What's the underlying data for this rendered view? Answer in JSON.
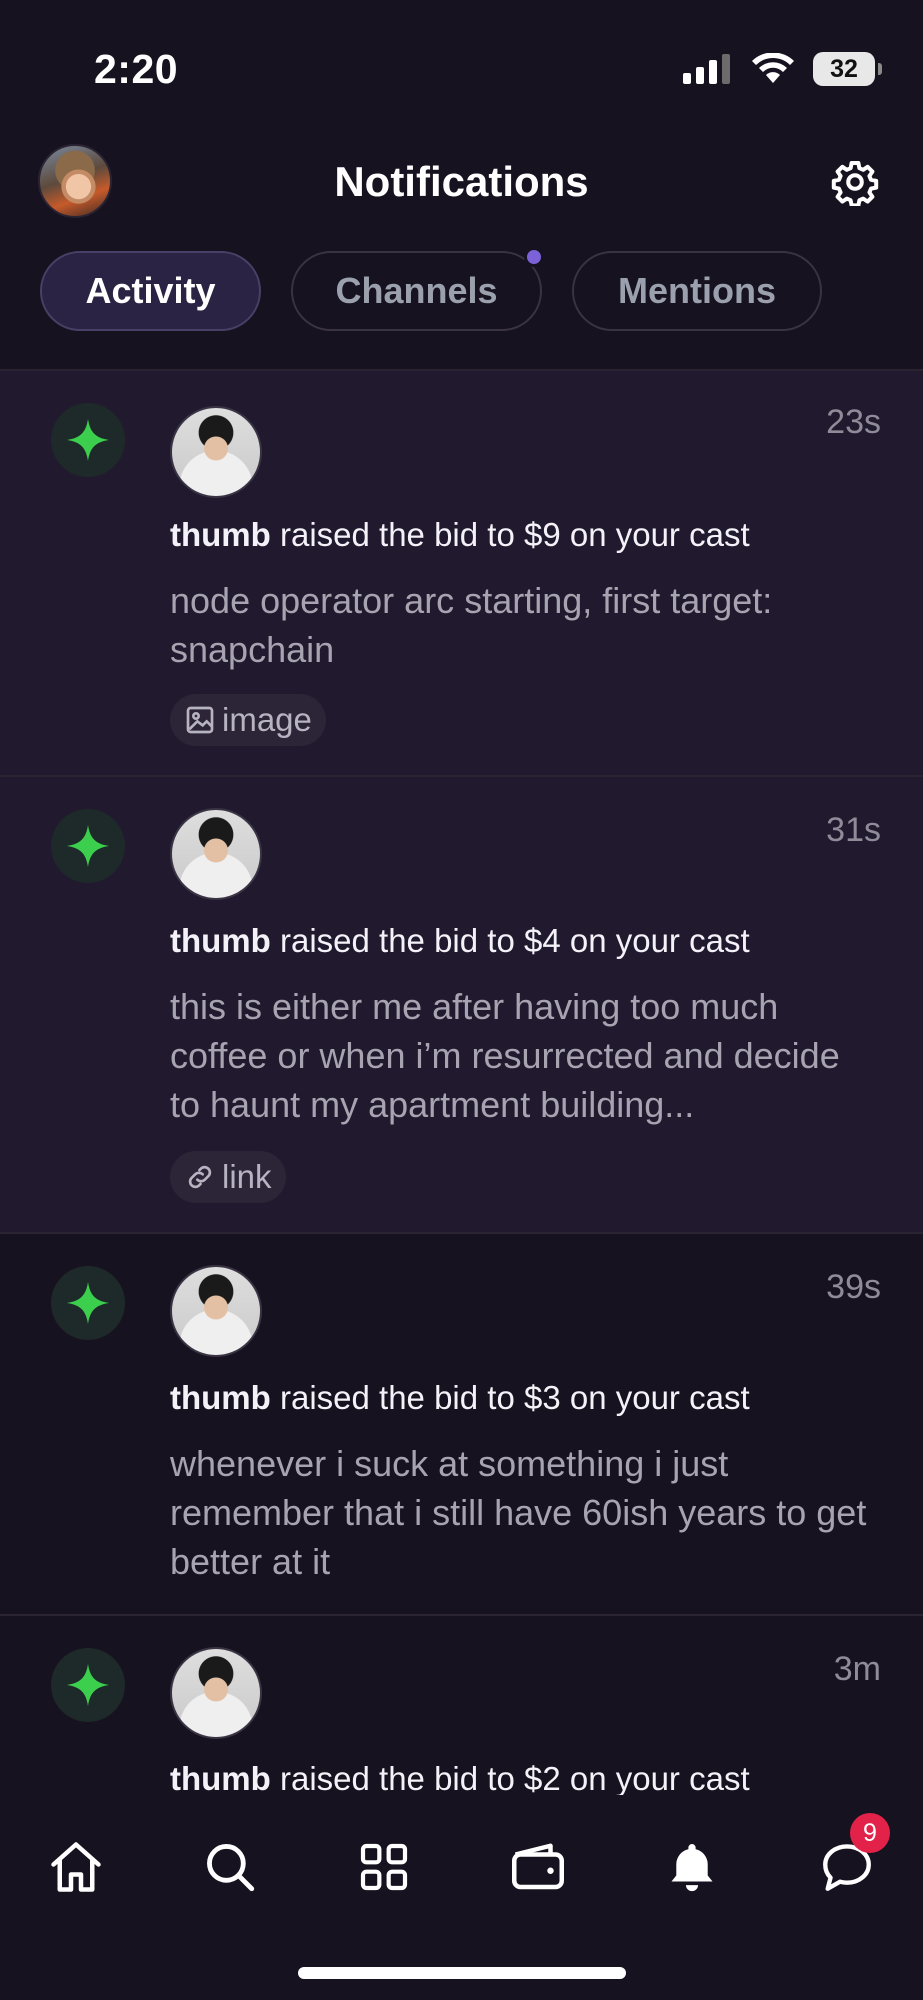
{
  "status_bar": {
    "time": "2:20",
    "battery": "32"
  },
  "header": {
    "title": "Notifications"
  },
  "tabs": [
    {
      "label": "Activity",
      "active": true
    },
    {
      "label": "Channels",
      "active": false,
      "has_dot": true
    },
    {
      "label": "Mentions",
      "active": false
    }
  ],
  "notifications": [
    {
      "time": "23s",
      "actor": "thumb",
      "action": "raised the bid to $9 on your cast",
      "body": "node operator arc starting, first target: snapchain",
      "embed": "image",
      "unread": true
    },
    {
      "time": "31s",
      "actor": "thumb",
      "action": "raised the bid to $4 on your cast",
      "body": "this is either me after having too much coffee or when i’m resurrected and decide to haunt my apartment building...",
      "embed": "link",
      "unread": true
    },
    {
      "time": "39s",
      "actor": "thumb",
      "action": "raised the bid to $3 on your cast",
      "body": "whenever i suck at something i just remember that i still have 60ish years to get better at it",
      "embed": "",
      "unread": false
    },
    {
      "time": "3m",
      "actor": "thumb",
      "action": "raised the bid to $2 on your cast",
      "body": "",
      "embed": "",
      "unread": false
    }
  ],
  "bottom_nav": {
    "items": [
      "home-icon",
      "search-icon",
      "grid-icon",
      "wallet-icon",
      "bell-icon",
      "chat-icon"
    ],
    "chat_badge": "9"
  },
  "colors": {
    "background": "#17121f",
    "unread_row": "#211a2f",
    "accent": "#7b62d8",
    "badge": "#e3224a",
    "bid_icon": "#3ccf4e"
  }
}
